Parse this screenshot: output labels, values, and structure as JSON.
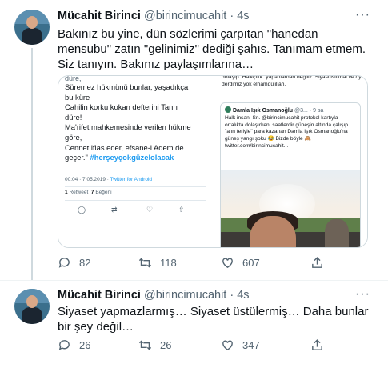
{
  "tweets": [
    {
      "author": {
        "name": "Mücahit Birinci",
        "handle": "@birincimucahit",
        "time": "· 4s"
      },
      "more_icon": "more-horizontal-icon",
      "text": "Bakınız bu yine, dün sözlerimi çarpıtan \"hanedan mensubu\" zatın \"gelinimiz\" dediği şahıs. Tanımam etmem. Siz tanıyın. Bakınız paylaşımlarına…",
      "media": {
        "left_screenshot": {
          "cut_text": "düre,",
          "lines": [
            "Süremez hükmünü bunlar, yaşadıkça",
            "bu küre",
            "Cahilin korku kokan defterini Tanrı",
            "düre!",
            "Ma'rifet mahkemesinde verilen hükme",
            "göre,",
            "Cennet iflas eder, efsane-i Adem de",
            "geçer.\""
          ],
          "hashtag": "#herşeyçokgüzelolacak",
          "time": "00:04 · 7.05.2019 ·",
          "source": "Twitter for Android",
          "retweets_count": "1",
          "retweets_label": "Retweet",
          "likes_count": "7",
          "likes_label": "Beğeni"
        },
        "right_screenshot": {
          "top_text": "dolaşıp \"Halkçıkk\" yapanlardan değiliz. Siyasi istikbal ve oy derdimiz yok elhamdülillah.",
          "quote_name": "Damla Işık Osmanoğlu",
          "quote_handle": "@3... · 9 sa",
          "quote_text": "Halk insanı Sn. @birincimucahit protokol kartıyla ortalıkta dolaşırken, saatlerdir güneşin altında çalışıp \"alın teriyle\" para kazanan Damla Işık Osmanoğlu'na güneş yangı şoku 😂 Bizde böyle 🙈 twitter.com/birincimucahit..."
        }
      },
      "stats": {
        "replies": "82",
        "retweets": "118",
        "likes": "607"
      }
    },
    {
      "author": {
        "name": "Mücahit Birinci",
        "handle": "@birincimucahit",
        "time": "· 4s"
      },
      "more_icon": "more-horizontal-icon",
      "text": "Siyaset yapmazlarmış… Siyaset üstülermiş… Daha bunlar bir şey değil…",
      "stats": {
        "replies": "26",
        "retweets": "26",
        "likes": "347"
      }
    }
  ],
  "icons": [
    "reply-icon",
    "retweet-icon",
    "like-icon",
    "share-icon",
    "more-horizontal-icon"
  ],
  "colors": {
    "text": "#0f1419",
    "secondary": "#536471",
    "link": "#1d9bf0",
    "border": "#cfd9de"
  }
}
